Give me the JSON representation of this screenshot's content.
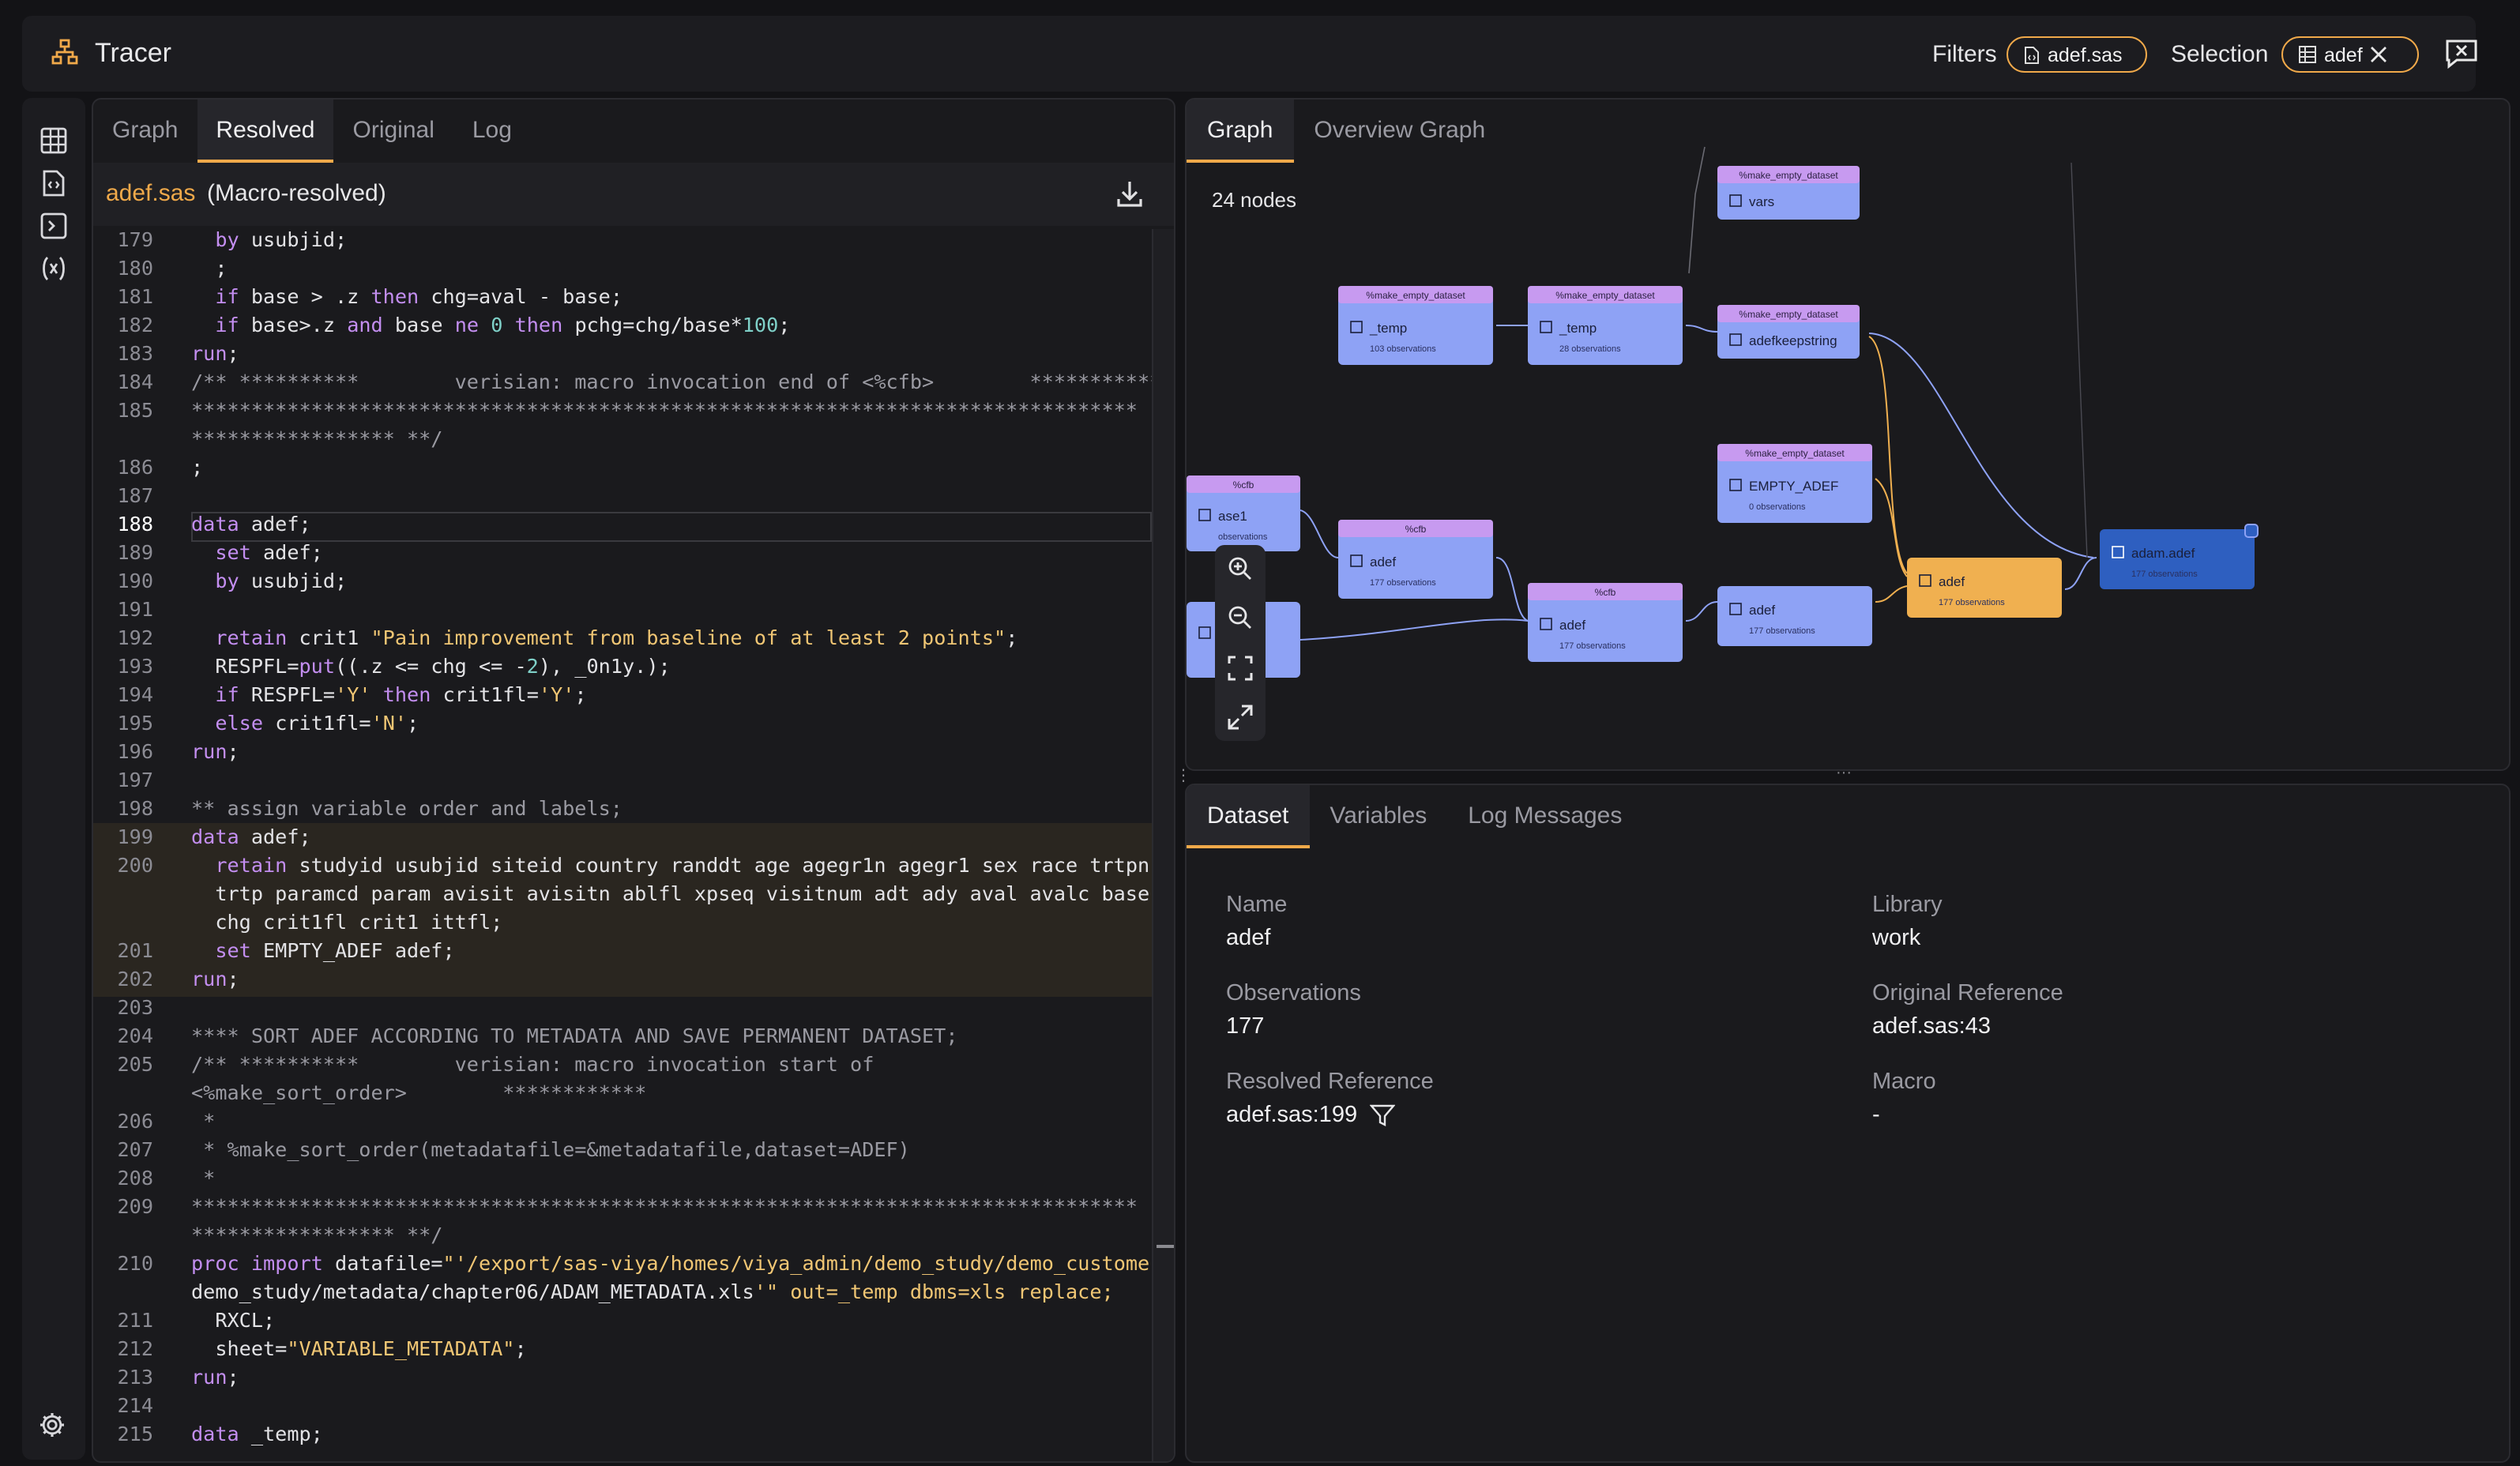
{
  "app": {
    "title": "Tracer"
  },
  "header": {
    "filters_label": "Filters",
    "filter_chip": "adef.sas",
    "selection_label": "Selection",
    "selection_chip": "adef"
  },
  "code_panel": {
    "tabs": [
      "Graph",
      "Resolved",
      "Original",
      "Log"
    ],
    "active_tab": "Resolved",
    "file_name": "adef.sas",
    "file_mode": "(Macro-resolved)"
  },
  "code_lines": [
    {
      "n": "179",
      "t": "  by usubjid;"
    },
    {
      "n": "180",
      "t": "  ;"
    },
    {
      "n": "181",
      "t": "  if base > .z then chg=aval - base;"
    },
    {
      "n": "182",
      "t": "  if base>.z and base ne 0 then pchg=chg/base*100;"
    },
    {
      "n": "183",
      "t": "run;"
    },
    {
      "n": "184",
      "t": "/** **********        verisian: macro invocation end of <%cfb>        ***********"
    },
    {
      "n": "185",
      "t": "*******************************************************************************"
    },
    {
      "n": "",
      "t": "***************** **/"
    },
    {
      "n": "186",
      "t": ";"
    },
    {
      "n": "187",
      "t": ""
    },
    {
      "n": "188",
      "t": "data adef;"
    },
    {
      "n": "189",
      "t": "  set adef;"
    },
    {
      "n": "190",
      "t": "  by usubjid;"
    },
    {
      "n": "191",
      "t": ""
    },
    {
      "n": "192",
      "t": "  retain crit1 \"Pain improvement from baseline of at least 2 points\";"
    },
    {
      "n": "193",
      "t": "  RESPFL=put((.z <= chg <= -2), _0n1y.);"
    },
    {
      "n": "194",
      "t": "  if RESPFL='Y' then crit1fl='Y';"
    },
    {
      "n": "195",
      "t": "  else crit1fl='N';"
    },
    {
      "n": "196",
      "t": "run;"
    },
    {
      "n": "197",
      "t": ""
    },
    {
      "n": "198",
      "t": "** assign variable order and labels;"
    },
    {
      "n": "199",
      "t": "data adef;"
    },
    {
      "n": "200",
      "t": "  retain studyid usubjid siteid country randdt age agegr1n agegr1 sex race trtpn"
    },
    {
      "n": "",
      "t": "  trtp paramcd param avisit avisitn ablfl xpseq visitnum adt ady aval avalc base"
    },
    {
      "n": "",
      "t": "  chg crit1fl crit1 ittfl;"
    },
    {
      "n": "201",
      "t": "  set EMPTY_ADEF adef;"
    },
    {
      "n": "202",
      "t": "run;"
    },
    {
      "n": "203",
      "t": ""
    },
    {
      "n": "204",
      "t": "**** SORT ADEF ACCORDING TO METADATA AND SAVE PERMANENT DATASET;"
    },
    {
      "n": "205",
      "t": "/** **********        verisian: macro invocation start of"
    },
    {
      "n": "",
      "t": "<%make_sort_order>        ************"
    },
    {
      "n": "206",
      "t": " *"
    },
    {
      "n": "207",
      "t": " * %make_sort_order(metadatafile=&metadatafile,dataset=ADEF)"
    },
    {
      "n": "208",
      "t": " *"
    },
    {
      "n": "209",
      "t": "*******************************************************************************"
    },
    {
      "n": "",
      "t": "***************** **/"
    },
    {
      "n": "210",
      "t": "proc import datafile=\"'/export/sas-viya/homes/viya_admin/demo_study/demo_customer/"
    },
    {
      "n": "",
      "t": "demo_study/metadata/chapter06/ADAM_METADATA.xls'\" out=_temp dbms=xls replace;"
    },
    {
      "n": "211",
      "t": "  RXCL;"
    },
    {
      "n": "212",
      "t": "  sheet=\"VARIABLE_METADATA\";"
    },
    {
      "n": "213",
      "t": "run;"
    },
    {
      "n": "214",
      "t": ""
    },
    {
      "n": "215",
      "t": "data _temp;"
    }
  ],
  "graph_panel": {
    "tabs": [
      "Graph",
      "Overview Graph"
    ],
    "active_tab": "Graph",
    "nodes_count": "24 nodes"
  },
  "graph_nodes": [
    {
      "id": "vars",
      "header": "%make_empty_dataset",
      "label": "vars",
      "sub": ""
    },
    {
      "id": "temp1",
      "header": "%make_empty_dataset",
      "label": "_temp",
      "sub": "103 observations"
    },
    {
      "id": "temp2",
      "header": "%make_empty_dataset",
      "label": "_temp",
      "sub": "28 observations"
    },
    {
      "id": "adefkeep",
      "header": "%make_empty_dataset",
      "label": "adefkeepstring",
      "sub": ""
    },
    {
      "id": "cfb_left",
      "header": "%cfb",
      "label": "ase1",
      "sub": "observations"
    },
    {
      "id": "empty_adef",
      "header": "%make_empty_dataset",
      "label": "EMPTY_ADEF",
      "sub": "0 observations"
    },
    {
      "id": "adef1",
      "header": "%cfb",
      "label": "adef",
      "sub": "177 observations"
    },
    {
      "id": "adef2",
      "header": "%cfb",
      "label": "adef",
      "sub": "177 observations"
    },
    {
      "id": "adef3",
      "header": "",
      "label": "adef",
      "sub": "177 observations"
    },
    {
      "id": "adef_sel",
      "header": "",
      "label": "adef",
      "sub": "177 observations"
    },
    {
      "id": "adam",
      "header": "",
      "label": "adam.adef",
      "sub": "177 observations"
    },
    {
      "id": "left2",
      "header": "",
      "label": "ase",
      "sub": "obs"
    }
  ],
  "info_panel": {
    "tabs": [
      "Dataset",
      "Variables",
      "Log Messages"
    ],
    "active_tab": "Dataset",
    "fields": {
      "name_label": "Name",
      "name_value": "adef",
      "library_label": "Library",
      "library_value": "work",
      "obs_label": "Observations",
      "obs_value": "177",
      "origref_label": "Original Reference",
      "origref_value": "adef.sas:43",
      "resref_label": "Resolved Reference",
      "resref_value": "adef.sas:199",
      "macro_label": "Macro",
      "macro_value": "-"
    }
  },
  "colors": {
    "accent": "#f0a94a",
    "node_blue": "#8ea2f5",
    "node_header": "#c79af0",
    "node_selected": "#f0b050",
    "node_dark": "#2e5fc0"
  }
}
